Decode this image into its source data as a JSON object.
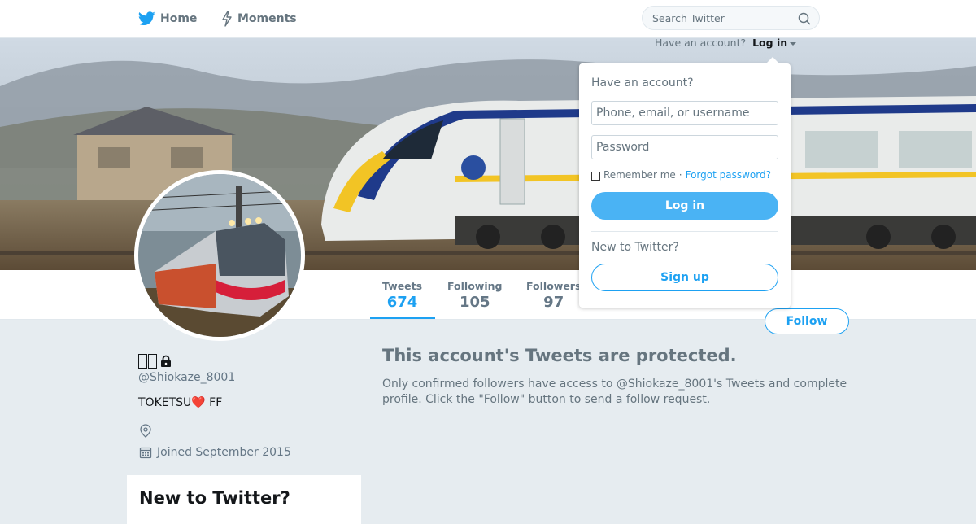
{
  "nav": {
    "home_label": "Home",
    "moments_label": "Moments",
    "search_placeholder": "Search Twitter"
  },
  "login_prompt": {
    "text": "Have an account?",
    "link": "Log in"
  },
  "stats": {
    "tweets_label": "Tweets",
    "tweets_value": "674",
    "following_label": "Following",
    "following_value": "105",
    "followers_label": "Followers",
    "followers_value": "97"
  },
  "follow_button": "Follow",
  "profile": {
    "name": "",
    "handle": "@Shiokaze_8001",
    "bio": "TOKETSU❤️ FF",
    "joined": "Joined September 2015"
  },
  "protected": {
    "title": "This account's Tweets are protected.",
    "text": "Only confirmed followers have access to @Shiokaze_8001's Tweets and complete profile. Click the \"Follow\" button to send a follow request."
  },
  "new_card": {
    "title": "New to Twitter?"
  },
  "dropdown": {
    "heading": "Have an account?",
    "username_placeholder": "Phone, email, or username",
    "password_placeholder": "Password",
    "remember": "Remember me",
    "separator": "·",
    "forgot": "Forgot password?",
    "login_button": "Log in",
    "new_heading": "New to Twitter?",
    "signup_button": "Sign up"
  },
  "colors": {
    "accent": "#1da1f2",
    "background": "#e6ecf0",
    "heart": "#e0245e"
  }
}
